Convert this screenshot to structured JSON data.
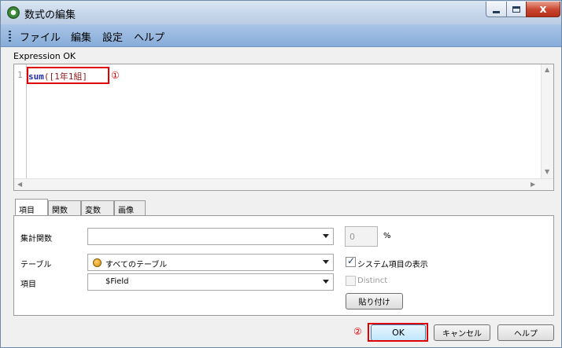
{
  "window": {
    "title": "数式の編集",
    "minimize_label": "",
    "maximize_label": "",
    "close_label": "x"
  },
  "menubar": {
    "items": [
      {
        "label": "ファイル"
      },
      {
        "label": "編集"
      },
      {
        "label": "設定"
      },
      {
        "label": "ヘルプ"
      }
    ]
  },
  "expression": {
    "status_label": "Expression OK",
    "line_number": "1",
    "code_function": "sum",
    "code_args": "([1年1組]",
    "annotation_marker": "①"
  },
  "tabs": [
    {
      "label": "項目",
      "active": true
    },
    {
      "label": "関数",
      "active": false
    },
    {
      "label": "変数",
      "active": false
    },
    {
      "label": "画像",
      "active": false
    }
  ],
  "panel": {
    "aggregate_label": "集計関数",
    "aggregate_value": "",
    "precision_value": "0",
    "precision_unit": "%",
    "table_label": "テーブル",
    "table_value": "すべてのテーブル",
    "field_label": "項目",
    "field_value": "$Field",
    "show_system_fields_label": "システム項目の表示",
    "show_system_fields_checked": true,
    "distinct_label": "Distinct",
    "distinct_checked": false,
    "paste_label": "貼り付け"
  },
  "footer": {
    "annotation_marker": "②",
    "ok_label": "OK",
    "cancel_label": "キャンセル",
    "help_label": "ヘルプ"
  },
  "colors": {
    "menubar": "#87acd9",
    "annotation_red": "#e00000",
    "code_function": "#1f2aaf"
  }
}
